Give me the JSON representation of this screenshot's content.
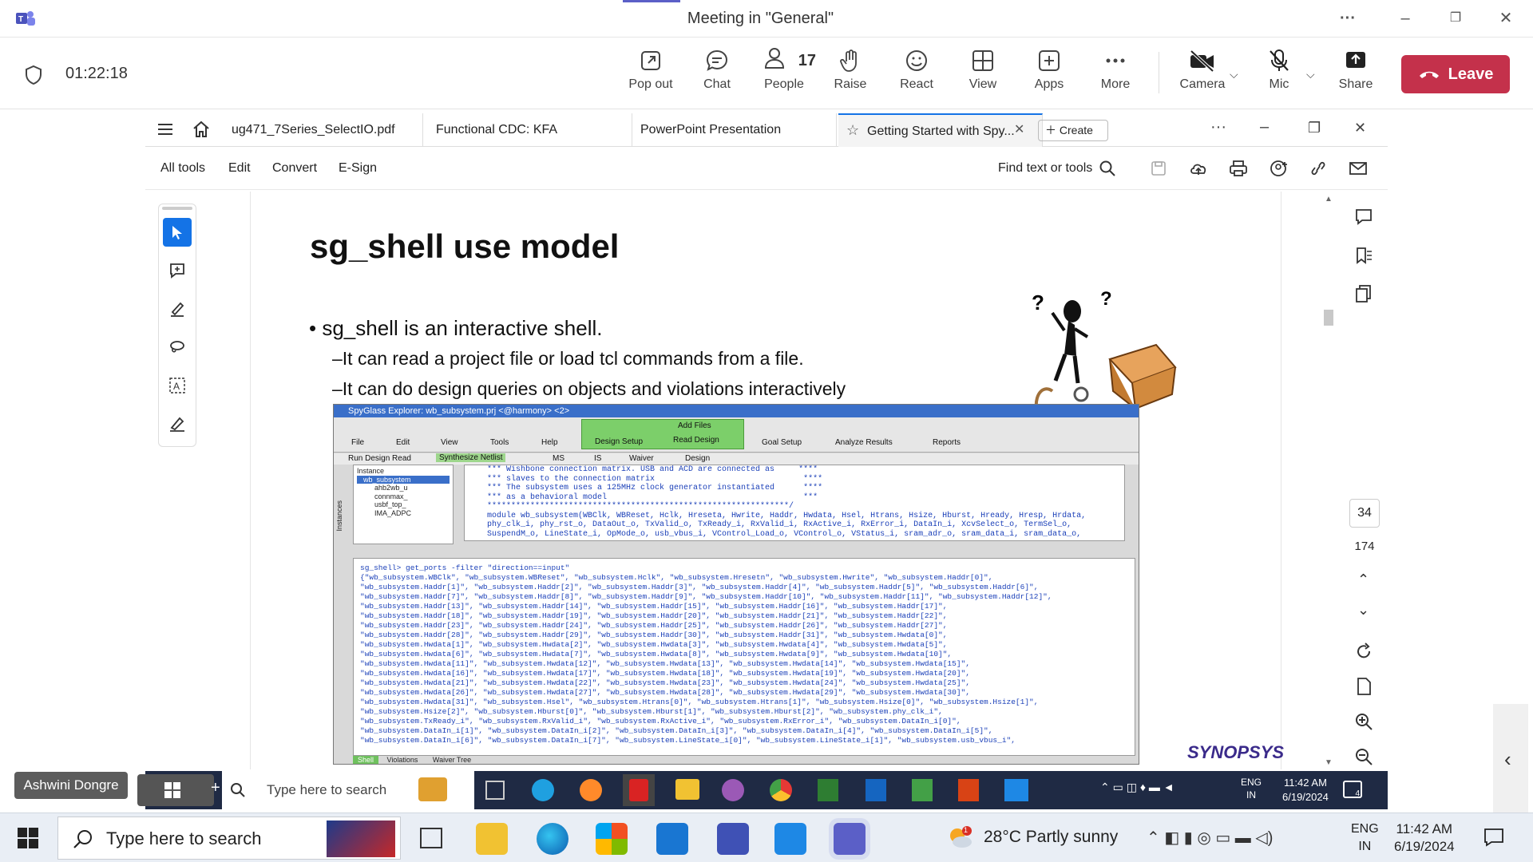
{
  "window": {
    "title": "Meeting in \"General\"",
    "more_label": "···"
  },
  "meeting": {
    "elapsed": "01:22:18"
  },
  "toolbar": {
    "popout": "Pop out",
    "chat": "Chat",
    "people": "People",
    "people_count": "17",
    "raise": "Raise",
    "react": "React",
    "view": "View",
    "apps": "Apps",
    "more": "More",
    "camera": "Camera",
    "mic": "Mic",
    "share": "Share",
    "leave": "Leave"
  },
  "acrobat": {
    "tabs": [
      "ug471_7Series_SelectIO.pdf",
      "Functional CDC: KFA",
      "PowerPoint Presentation",
      "Getting Started with Spy..."
    ],
    "create_label": "Create",
    "menu": [
      "All tools",
      "Edit",
      "Convert",
      "E-Sign"
    ],
    "find_label": "Find text or tools",
    "page_current": "34",
    "page_total": "174"
  },
  "slide": {
    "title": "sg_shell use model",
    "bullet1": "• sg_shell is an interactive shell.",
    "sub1": "–It can read a project file or load tcl commands from a file.",
    "sub2": "–It can do design queries on objects and violations interactively",
    "logo": "SYNOPSYS"
  },
  "spyglass": {
    "title": "SpyGlass Explorer: wb_subsystem.prj <@harmony> <2>",
    "menu": [
      "File",
      "Edit",
      "View",
      "Tools",
      "Help"
    ],
    "design_setup": "Design Setup",
    "add_files": "Add Files",
    "read_design": "Read Design",
    "goal_setup": "Goal Setup",
    "analyze": "Analyze Results",
    "reports": "Reports",
    "row2": [
      "Run Design Read",
      "Synthesize Netlist",
      "MS",
      "IS",
      "Waiver",
      "Design"
    ],
    "instance_header": "Instance",
    "instances": [
      "wb_subsystem",
      "ahb2wb_u",
      "connmax_",
      "usbf_top_",
      "IMA_ADPC"
    ],
    "code_top": "*** Wishbone connection matrix. USB and ACD are connected as     ****\n*** slaves to the connection matrix                               ****\n*** The subsystem uses a 125MHz clock generator instantiated      ****\n*** as a behavioral model                                         ***\n***************************************************************/\nmodule wb_subsystem(WBClk, WBReset, Hclk, Hreseta, Hwrite, Haddr, Hwdata, Hsel, Htrans, Hsize, Hburst, Hready, Hresp, Hrdata,\nphy_clk_i, phy_rst_o, DataOut_o, TxValid_o, TxReady_i, RxValid_i, RxActive_i, RxError_i, DataIn_i, XcvSelect_o, TermSel_o,\nSuspendM_o, LineState_i, OpMode_o, usb_vbus_i, VControl_Load_o, VControl_o, VStatus_i, sram_adr_o, sram_data_i, sram_data_o,",
    "code_bottom": "sg_shell> get_ports -filter \"direction==input\"\n{\"wb_subsystem.WBClk\", \"wb_subsystem.WBReset\", \"wb_subsystem.Hclk\", \"wb_subsystem.Hresetn\", \"wb_subsystem.Hwrite\", \"wb_subsystem.Haddr[0]\",\n\"wb_subsystem.Haddr[1]\", \"wb_subsystem.Haddr[2]\", \"wb_subsystem.Haddr[3]\", \"wb_subsystem.Haddr[4]\", \"wb_subsystem.Haddr[5]\", \"wb_subsystem.Haddr[6]\",\n\"wb_subsystem.Haddr[7]\", \"wb_subsystem.Haddr[8]\", \"wb_subsystem.Haddr[9]\", \"wb_subsystem.Haddr[10]\", \"wb_subsystem.Haddr[11]\", \"wb_subsystem.Haddr[12]\",\n\"wb_subsystem.Haddr[13]\", \"wb_subsystem.Haddr[14]\", \"wb_subsystem.Haddr[15]\", \"wb_subsystem.Haddr[16]\", \"wb_subsystem.Haddr[17]\",\n\"wb_subsystem.Haddr[18]\", \"wb_subsystem.Haddr[19]\", \"wb_subsystem.Haddr[20]\", \"wb_subsystem.Haddr[21]\", \"wb_subsystem.Haddr[22]\",\n\"wb_subsystem.Haddr[23]\", \"wb_subsystem.Haddr[24]\", \"wb_subsystem.Haddr[25]\", \"wb_subsystem.Haddr[26]\", \"wb_subsystem.Haddr[27]\",\n\"wb_subsystem.Haddr[28]\", \"wb_subsystem.Haddr[29]\", \"wb_subsystem.Haddr[30]\", \"wb_subsystem.Haddr[31]\", \"wb_subsystem.Hwdata[0]\",\n\"wb_subsystem.Hwdata[1]\", \"wb_subsystem.Hwdata[2]\", \"wb_subsystem.Hwdata[3]\", \"wb_subsystem.Hwdata[4]\", \"wb_subsystem.Hwdata[5]\",\n\"wb_subsystem.Hwdata[6]\", \"wb_subsystem.Hwdata[7]\", \"wb_subsystem.Hwdata[8]\", \"wb_subsystem.Hwdata[9]\", \"wb_subsystem.Hwdata[10]\",\n\"wb_subsystem.Hwdata[11]\", \"wb_subsystem.Hwdata[12]\", \"wb_subsystem.Hwdata[13]\", \"wb_subsystem.Hwdata[14]\", \"wb_subsystem.Hwdata[15]\",\n\"wb_subsystem.Hwdata[16]\", \"wb_subsystem.Hwdata[17]\", \"wb_subsystem.Hwdata[18]\", \"wb_subsystem.Hwdata[19]\", \"wb_subsystem.Hwdata[20]\",\n\"wb_subsystem.Hwdata[21]\", \"wb_subsystem.Hwdata[22]\", \"wb_subsystem.Hwdata[23]\", \"wb_subsystem.Hwdata[24]\", \"wb_subsystem.Hwdata[25]\",\n\"wb_subsystem.Hwdata[26]\", \"wb_subsystem.Hwdata[27]\", \"wb_subsystem.Hwdata[28]\", \"wb_subsystem.Hwdata[29]\", \"wb_subsystem.Hwdata[30]\",\n\"wb_subsystem.Hwdata[31]\", \"wb_subsystem.Hsel\", \"wb_subsystem.Htrans[0]\", \"wb_subsystem.Htrans[1]\", \"wb_subsystem.Hsize[0]\", \"wb_subsystem.Hsize[1]\",\n\"wb_subsystem.Hsize[2]\", \"wb_subsystem.Hburst[0]\", \"wb_subsystem.Hburst[1]\", \"wb_subsystem.Hburst[2]\", \"wb_subsystem.phy_clk_i\",\n\"wb_subsystem.TxReady_i\", \"wb_subsystem.RxValid_i\", \"wb_subsystem.RxActive_i\", \"wb_subsystem.RxError_i\", \"wb_subsystem.DataIn_i[0]\",\n\"wb_subsystem.DataIn_i[1]\", \"wb_subsystem.DataIn_i[2]\", \"wb_subsystem.DataIn_i[3]\", \"wb_subsystem.DataIn_i[4]\", \"wb_subsystem.DataIn_i[5]\",\n\"wb_subsystem.DataIn_i[6]\", \"wb_subsystem.DataIn_i[7]\", \"wb_subsystem.LineState_i[0]\", \"wb_subsystem.LineState_i[1]\", \"wb_subsystem.usb_vbus_i\",",
    "bottom_tabs": [
      "Shell",
      "Violations",
      "Waiver Tree"
    ],
    "left_tabs": [
      "Instances"
    ]
  },
  "presenter": {
    "name": "Ashwini Dongre"
  },
  "inner_taskbar": {
    "search": "Type here to search",
    "lang1": "ENG",
    "lang2": "IN",
    "time": "11:42 AM",
    "date": "6/19/2024",
    "notif_count": "4"
  },
  "taskbar": {
    "search": "Type here to search",
    "weather": "28°C  Partly sunny",
    "lang1": "ENG",
    "lang2": "IN",
    "time": "11:42 AM",
    "date": "6/19/2024",
    "weather_badge": "1"
  },
  "colors": {
    "teams_accent": "#5b5fc7",
    "leave": "#c4314b",
    "acrobat_blue": "#1473e6"
  }
}
